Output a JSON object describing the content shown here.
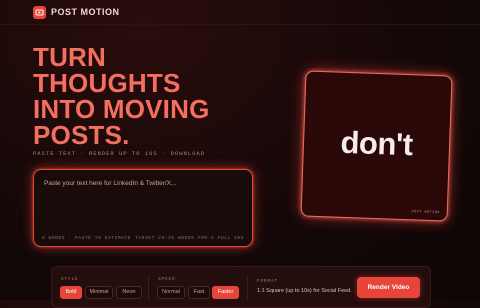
{
  "app": {
    "brand": "POST MOTION",
    "logo_icon": "film-play-icon",
    "accent_color": "#e8453a"
  },
  "hero": {
    "title_lines": [
      "TURN",
      "THOUGHTS",
      "INTO MOVING",
      "POSTS."
    ],
    "subtitle": "PASTE TEXT · RENDER UP TO 10S · DOWNLOAD"
  },
  "editor": {
    "placeholder": "Paste your text here for LinkedIn & Twitter/X...",
    "value": "",
    "word_count": "0 WORDS · PASTE TO ESTIMATE",
    "target_hint": "TARGET 20–25 WORDS FOR A FULL 10S"
  },
  "preview": {
    "word": "don't",
    "tag": "POST MOTION"
  },
  "controls": {
    "style": {
      "label": "STYLE",
      "options": [
        "Bold",
        "Minimal",
        "Neon"
      ],
      "selected": "Bold"
    },
    "speed": {
      "label": "SPEED",
      "options": [
        "Normal",
        "Fast",
        "Faster"
      ],
      "selected": "Faster"
    },
    "format": {
      "label": "FORMAT",
      "value": "1:1 Square (up to 10s) for Social Feed."
    },
    "render_label": "Render Video"
  }
}
